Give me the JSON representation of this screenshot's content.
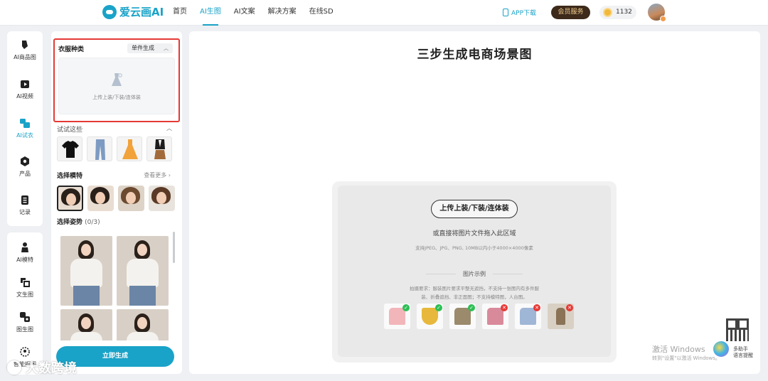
{
  "header": {
    "logo_text": "爱云画AI",
    "nav": [
      "首页",
      "AI生图",
      "AI文案",
      "解决方案",
      "在线SD"
    ],
    "active_nav": "AI生图",
    "app_download": "APP下载",
    "vip": "会员服务",
    "coins": "1132"
  },
  "rail_top": [
    {
      "label": "AI商品图",
      "icon": "brush-icon"
    },
    {
      "label": "AI视频",
      "icon": "video-icon"
    },
    {
      "label": "AI试衣",
      "icon": "tryon-icon",
      "active": true
    },
    {
      "label": "产品",
      "icon": "product-icon"
    },
    {
      "label": "记录",
      "icon": "record-icon"
    }
  ],
  "rail_bottom": [
    {
      "label": "AI模特",
      "icon": "model-icon"
    },
    {
      "label": "文生图",
      "icon": "text-to-image-icon"
    },
    {
      "label": "图生图",
      "icon": "image-to-image-icon"
    },
    {
      "label": "智能抠图",
      "icon": "matting-icon"
    }
  ],
  "panel": {
    "clothing_type": "衣服种类",
    "mode": "单件生成",
    "upload_hint": "上传上装/下装/连体装",
    "try_these": "试试这些",
    "choose_model": "选择模特",
    "see_more": "查看更多",
    "choose_pose": "选择姿势",
    "pose_count": "(0/3)",
    "generate": "立即生成"
  },
  "main": {
    "title": "三步生成电商场景图",
    "upload_button": "上传上装/下装/连体装",
    "drag_hint": "或直接将图片文件拖入此区域",
    "format_hint": "支持JPEG、JPG、PNG, 10MB以内小于4000×4000像素",
    "example_title": "图片示例",
    "requirement_line1": "拍摄要求：服装图片要求平整无遮挡，不支持一张图内有多件服",
    "requirement_line2": "装、折叠遮挡、非正面图；不支持模特图，人台图。"
  },
  "examples": [
    {
      "ok": true,
      "color": "#f2b5ba"
    },
    {
      "ok": true,
      "color": "#e7b83b"
    },
    {
      "ok": true,
      "color": "#9b8a6c"
    },
    {
      "ok": false,
      "color": "#d98a9a"
    },
    {
      "ok": false,
      "color": "#9fb6d6"
    },
    {
      "ok": false,
      "color": "#8a7356"
    }
  ],
  "overlay": {
    "windows_line1": "激活 Windows",
    "windows_line2": "转到\"设置\"以激活 Windows。",
    "assistant": "多助手\n语言提醒",
    "watermark": "大数跨境"
  }
}
